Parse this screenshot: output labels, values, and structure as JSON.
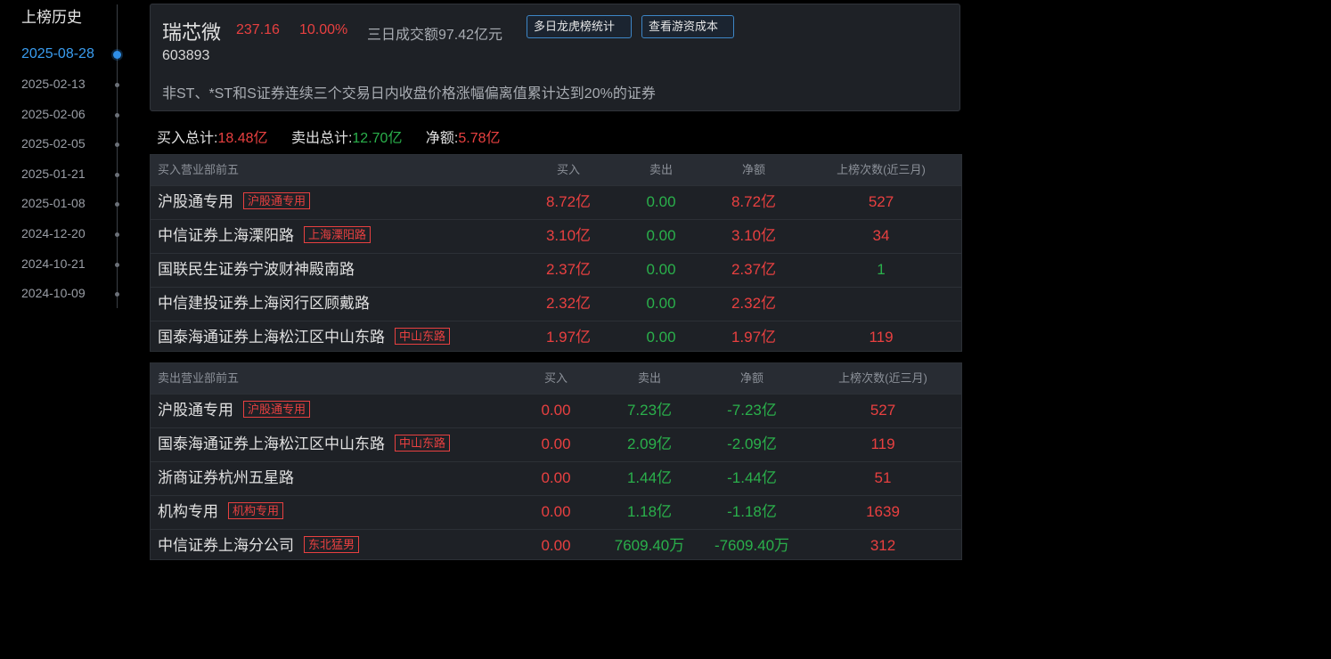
{
  "sidebar": {
    "title": "上榜历史",
    "dates": [
      "2025-08-28",
      "2025-02-13",
      "2025-02-06",
      "2025-02-05",
      "2025-01-21",
      "2025-01-08",
      "2024-12-20",
      "2024-10-21",
      "2024-10-09"
    ],
    "active_index": 0
  },
  "header": {
    "name": "瑞芯微",
    "price": "237.16",
    "change_pct": "10.00%",
    "turnover": "三日成交额97.42亿元",
    "btn_stats": "多日龙虎榜统计",
    "btn_cost": "查看游资成本",
    "code": "603893",
    "reason": "非ST、*ST和S证券连续三个交易日内收盘价格涨幅偏离值累计达到20%的证券"
  },
  "totals": {
    "buy_label": "买入总计:",
    "buy_value": "18.48亿",
    "sell_label": "卖出总计:",
    "sell_value": "12.70亿",
    "net_label": "净额:",
    "net_value": "5.78亿"
  },
  "buy_table": {
    "headers": [
      "买入营业部前五",
      "买入",
      "卖出",
      "净额",
      "上榜次数(近三月)"
    ],
    "rows": [
      {
        "name": "沪股通专用",
        "tag": "沪股通专用",
        "buy": "8.72亿",
        "sell": "0.00",
        "net": "8.72亿",
        "count": "527",
        "count_color": "red"
      },
      {
        "name": "中信证券上海溧阳路",
        "tag": "上海溧阳路",
        "buy": "3.10亿",
        "sell": "0.00",
        "net": "3.10亿",
        "count": "34",
        "count_color": "red"
      },
      {
        "name": "国联民生证券宁波财神殿南路",
        "tag": "",
        "buy": "2.37亿",
        "sell": "0.00",
        "net": "2.37亿",
        "count": "1",
        "count_color": "green"
      },
      {
        "name": "中信建投证券上海闵行区顾戴路",
        "tag": "",
        "buy": "2.32亿",
        "sell": "0.00",
        "net": "2.32亿",
        "count": "",
        "count_color": "red"
      },
      {
        "name": "国泰海通证券上海松江区中山东路",
        "tag": "中山东路",
        "buy": "1.97亿",
        "sell": "0.00",
        "net": "1.97亿",
        "count": "119",
        "count_color": "red"
      }
    ]
  },
  "sell_table": {
    "headers": [
      "卖出营业部前五",
      "买入",
      "卖出",
      "净额",
      "上榜次数(近三月)"
    ],
    "rows": [
      {
        "name": "沪股通专用",
        "tag": "沪股通专用",
        "buy": "0.00",
        "sell": "7.23亿",
        "net": "-7.23亿",
        "count": "527"
      },
      {
        "name": "国泰海通证券上海松江区中山东路",
        "tag": "中山东路",
        "buy": "0.00",
        "sell": "2.09亿",
        "net": "-2.09亿",
        "count": "119"
      },
      {
        "name": "浙商证券杭州五星路",
        "tag": "",
        "buy": "0.00",
        "sell": "1.44亿",
        "net": "-1.44亿",
        "count": "51"
      },
      {
        "name": "机构专用",
        "tag": "机构专用",
        "buy": "0.00",
        "sell": "1.18亿",
        "net": "-1.18亿",
        "count": "1639"
      },
      {
        "name": "中信证券上海分公司",
        "tag": "东北猛男",
        "buy": "0.00",
        "sell": "7609.40万",
        "net": "-7609.40万",
        "count": "312"
      }
    ]
  },
  "colors": {
    "up": "#e84040",
    "down": "#2ab04b",
    "accent": "#3a9df0"
  }
}
